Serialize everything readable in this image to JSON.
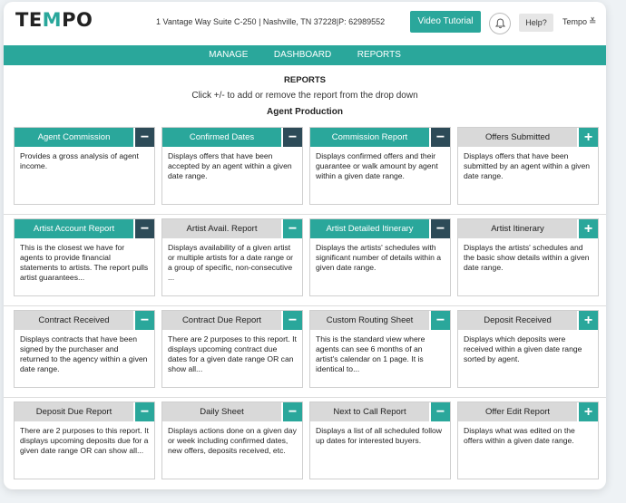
{
  "header": {
    "logo_text_1": "TE",
    "logo_text_2": "M",
    "logo_text_3": "PO",
    "address": "1 Vantage Way Suite C-250 | Nashville, TN 37228|P: 62989552",
    "video_tutorial_label": "Video Tutorial",
    "help_label": "Help?",
    "user_label": "Tempo"
  },
  "nav": {
    "items": [
      "MANAGE",
      "DASHBOARD",
      "REPORTS"
    ]
  },
  "page": {
    "title": "REPORTS",
    "instruction": "Click +/- to add or remove the report from the drop down",
    "section": "Agent Production"
  },
  "colors": {
    "accent": "#2aa79b",
    "minus_btn": "#2d4b58",
    "inactive_head": "#d9d9d9"
  },
  "reports": [
    {
      "title": "Agent Commission",
      "active": true,
      "toggle": "−",
      "desc": "Provides a gross analysis of agent income."
    },
    {
      "title": "Confirmed Dates",
      "active": true,
      "toggle": "−",
      "desc": "Displays offers that have been accepted by an agent within a given date range."
    },
    {
      "title": "Commission Report",
      "active": true,
      "toggle": "−",
      "desc": "Displays confirmed offers and their guarantee or walk amount by agent within a given date range."
    },
    {
      "title": "Offers Submitted",
      "active": false,
      "toggle": "+",
      "desc": "Displays offers that have been submitted by an agent within a given date range."
    },
    {
      "title": "Artist Account Report",
      "active": true,
      "toggle": "−",
      "desc": "This is the closest we have for agents to provide financial statements to artists. The report pulls artist guarantees..."
    },
    {
      "title": "Artist Avail. Report",
      "active": false,
      "toggle": "−",
      "desc": "Displays availability of a given artist or multiple artists for a date range or a group of specific, non-consecutive ..."
    },
    {
      "title": "Artist Detailed Itinerary",
      "active": true,
      "toggle": "−",
      "desc": "Displays the artists' schedules with significant number of details within a given date range."
    },
    {
      "title": "Artist Itinerary",
      "active": false,
      "toggle": "+",
      "desc": "Displays the artists' schedules and the basic show details within a given date range."
    },
    {
      "title": "Contract Received",
      "active": false,
      "toggle": "−",
      "desc": "Displays contracts that have been signed by the purchaser and returned to the agency within a given date range."
    },
    {
      "title": "Contract Due Report",
      "active": false,
      "toggle": "−",
      "desc": "There are 2 purposes to this report. It displays upcoming contract due dates for a given date range OR can show all..."
    },
    {
      "title": "Custom Routing Sheet",
      "active": false,
      "toggle": "−",
      "desc": "This is the standard view where agents can see 6 months of an artist's calendar on 1 page. It is identical to..."
    },
    {
      "title": "Deposit Received",
      "active": false,
      "toggle": "+",
      "desc": "Displays which deposits were received within a given date range sorted by agent."
    },
    {
      "title": "Deposit Due Report",
      "active": false,
      "toggle": "−",
      "desc": "There are 2 purposes to this report. It displays upcoming deposits due for a given date range OR can show all..."
    },
    {
      "title": "Daily Sheet",
      "active": false,
      "toggle": "−",
      "desc": "Displays actions done on a given day or week including confirmed dates, new offers, deposits received, etc."
    },
    {
      "title": "Next to Call Report",
      "active": false,
      "toggle": "−",
      "desc": "Displays a list of all scheduled follow up dates for interested buyers."
    },
    {
      "title": "Offer Edit Report",
      "active": false,
      "toggle": "+",
      "desc": "Displays what was edited on the offers within a given date range."
    }
  ]
}
